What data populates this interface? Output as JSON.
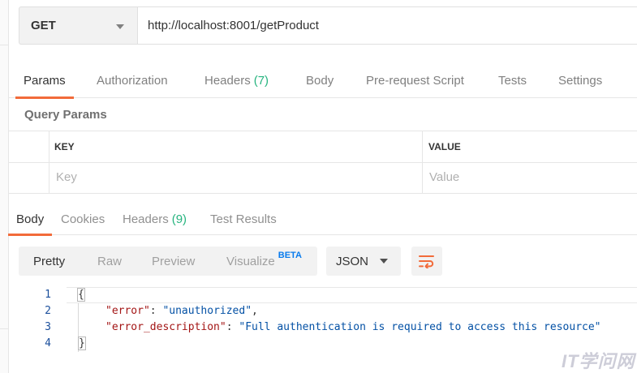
{
  "request": {
    "method": "GET",
    "url": "http://localhost:8001/getProduct"
  },
  "request_tabs": [
    {
      "label": "Params",
      "count": "",
      "active": true
    },
    {
      "label": "Authorization",
      "count": ""
    },
    {
      "label": "Headers",
      "count": "(7)"
    },
    {
      "label": "Body",
      "count": ""
    },
    {
      "label": "Pre-request Script",
      "count": ""
    },
    {
      "label": "Tests",
      "count": ""
    },
    {
      "label": "Settings",
      "count": ""
    }
  ],
  "query_params": {
    "title": "Query Params",
    "columns": {
      "key": "KEY",
      "value": "VALUE"
    },
    "placeholders": {
      "key": "Key",
      "value": "Value"
    }
  },
  "response_tabs": [
    {
      "label": "Body",
      "count": "",
      "active": true
    },
    {
      "label": "Cookies",
      "count": ""
    },
    {
      "label": "Headers",
      "count": "(9)"
    },
    {
      "label": "Test Results",
      "count": ""
    }
  ],
  "format_buttons": [
    {
      "label": "Pretty",
      "active": true
    },
    {
      "label": "Raw"
    },
    {
      "label": "Preview"
    },
    {
      "label": "Visualize",
      "badge": "BETA"
    }
  ],
  "format_select": "JSON",
  "icons": {
    "method_dropdown": "chevron-down-icon",
    "format_dropdown": "chevron-down-icon",
    "wrap": "wrap-lines-icon"
  },
  "colors": {
    "accent": "#f26b3a",
    "count": "#26b47f",
    "beta": "#097bed",
    "json_key": "#a31515",
    "json_string": "#0451a5"
  },
  "response_code": {
    "lines": [
      {
        "num": "1",
        "open": "{"
      },
      {
        "num": "2",
        "key": "\"error\"",
        "sep": ": ",
        "value": "\"unauthorized\"",
        "end": ","
      },
      {
        "num": "3",
        "key": "\"error_description\"",
        "sep": ": ",
        "value": "\"Full authentication is required to access this resource\"",
        "end": ""
      },
      {
        "num": "4",
        "close": "}"
      }
    ]
  },
  "watermark": "IT学问网"
}
